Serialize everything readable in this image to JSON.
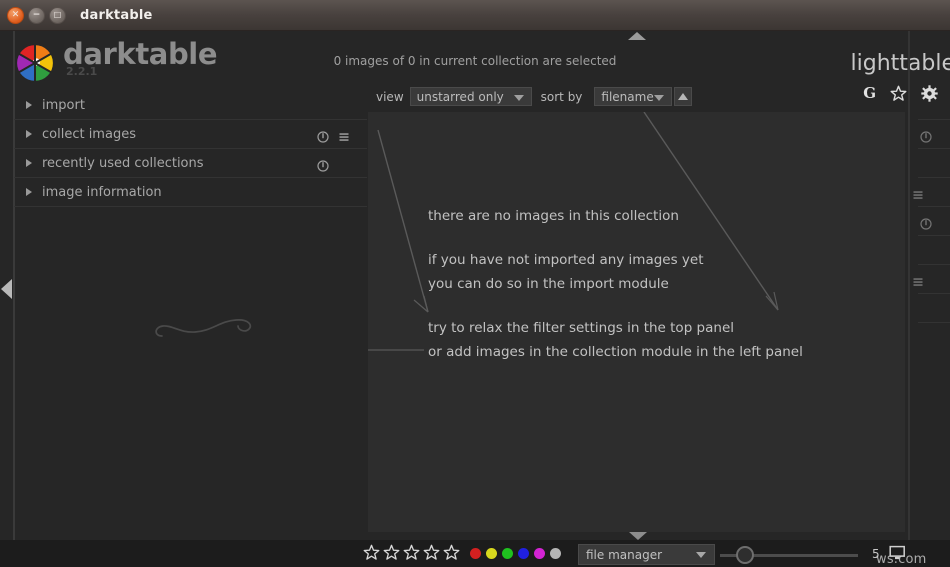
{
  "window": {
    "title": "darktable",
    "controls": [
      {
        "name": "close",
        "glyph": "✕"
      },
      {
        "name": "minimize",
        "glyph": "−"
      },
      {
        "name": "maximize",
        "glyph": "□"
      }
    ]
  },
  "brand": {
    "name": "darktable",
    "version": "2.2.1",
    "logo_colors": [
      "#e8442a",
      "#ef7d16",
      "#f2c20a",
      "#7dbe28",
      "#1f9b4a",
      "#2f6fc4",
      "#3f3fb5",
      "#8b2fb0",
      "#d01b8c"
    ]
  },
  "header": {
    "collection_status": "0 images of 0 in current collection are selected",
    "view_mode": "lighttable"
  },
  "filterbar": {
    "view_label": "view",
    "view_value": "unstarred only",
    "sort_label": "sort by",
    "sort_value": "filename",
    "sort_direction": "ascending"
  },
  "top_icons": [
    {
      "name": "grouping-icon",
      "label": "G"
    },
    {
      "name": "overlays-star-icon",
      "label": ""
    },
    {
      "name": "preferences-gear-icon",
      "label": ""
    }
  ],
  "left_panel": {
    "modules": [
      {
        "label": "import",
        "has_reset": false,
        "has_presets": false
      },
      {
        "label": "collect images",
        "has_reset": true,
        "has_presets": true
      },
      {
        "label": "recently used collections",
        "has_reset": true,
        "has_presets": false
      },
      {
        "label": "image information",
        "has_reset": false,
        "has_presets": false
      }
    ]
  },
  "center": {
    "messages": [
      [
        "there are no images in this collection"
      ],
      [
        "if you have not imported any images yet",
        "you can do so in the import module"
      ],
      [
        "try to relax the filter settings in the top panel",
        "or add images in the collection module in the left panel"
      ]
    ]
  },
  "right_panel": {
    "modules": [
      {
        "icon": "none"
      },
      {
        "icon": "reset"
      },
      {
        "icon": "none"
      },
      {
        "icon": "presets"
      },
      {
        "icon": "reset"
      },
      {
        "icon": "none"
      },
      {
        "icon": "presets"
      },
      {
        "icon": "none"
      }
    ]
  },
  "bottombar": {
    "star_count": 5,
    "color_labels": [
      {
        "name": "red",
        "color": "#d42020"
      },
      {
        "name": "yellow",
        "color": "#d8d81e"
      },
      {
        "name": "green",
        "color": "#1fc21f"
      },
      {
        "name": "blue",
        "color": "#2020e0"
      },
      {
        "name": "purple",
        "color": "#d424d4"
      },
      {
        "name": "gray",
        "color": "#b4b4b4"
      }
    ],
    "layout_value": "file manager",
    "zoom_level": "5"
  },
  "watermark": "ws.com"
}
